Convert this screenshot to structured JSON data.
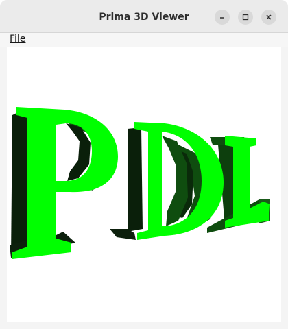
{
  "window": {
    "title": "Prima 3D Viewer",
    "controls": [
      "minimize",
      "maximize",
      "close"
    ]
  },
  "menubar": {
    "items": [
      {
        "label": "File"
      }
    ]
  },
  "scene": {
    "text": "PDL",
    "colors": {
      "face": "#00ff00",
      "side_dark": "#0a1f0a",
      "side_mid": "#0f4d0f",
      "background": "#ffffff"
    }
  }
}
